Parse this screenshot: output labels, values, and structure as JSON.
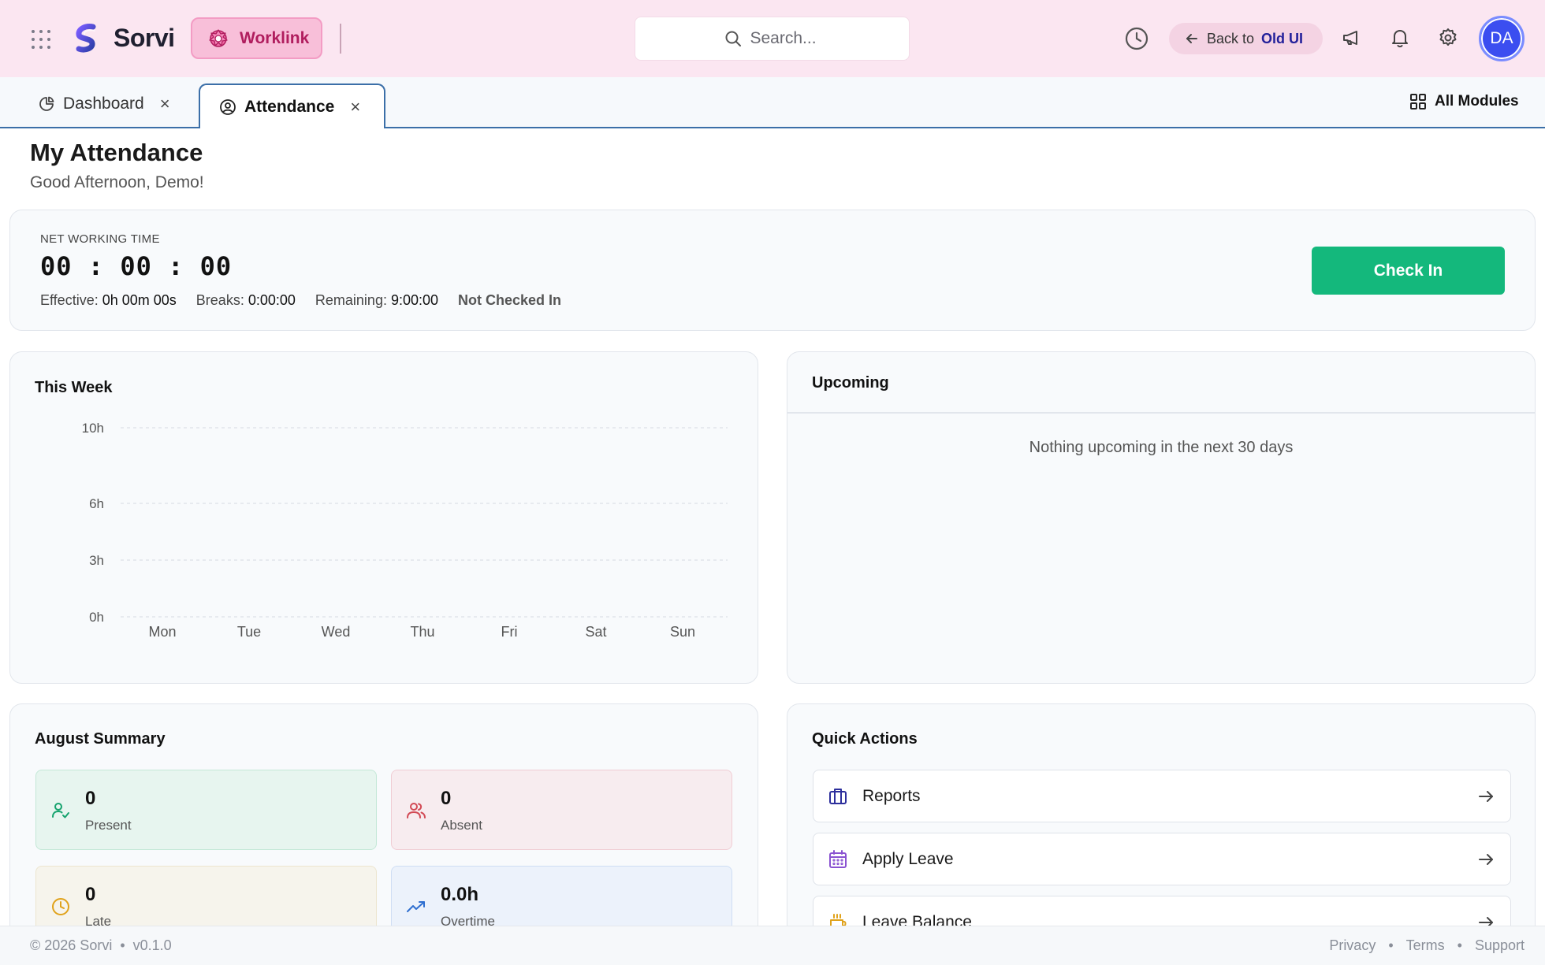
{
  "header": {
    "brand": "Sorvi",
    "module": "Worklink",
    "search_placeholder": "Search...",
    "back_prefix": "Back to",
    "back_target": "Old UI",
    "avatar_initials": "DA",
    "colors": {
      "header_bg": "#fbe6f1",
      "module_accent": "#b01d5e",
      "avatar": "#3b4ef0"
    }
  },
  "tabs": [
    {
      "label": "Dashboard",
      "icon": "pie-chart-icon",
      "active": false
    },
    {
      "label": "Attendance",
      "icon": "user-circle-icon",
      "active": true
    }
  ],
  "all_modules": "All Modules",
  "page": {
    "title": "My Attendance",
    "greeting": "Good Afternoon, Demo!"
  },
  "net": {
    "label": "NET WORKING TIME",
    "timer": "00 : 00 : 00",
    "effective_label": "Effective:",
    "effective_value": "0h 00m 00s",
    "breaks_label": "Breaks:",
    "breaks_value": "0:00:00",
    "remaining_label": "Remaining:",
    "remaining_value": "9:00:00",
    "status": "Not Checked In",
    "checkin_label": "Check In",
    "checkin_color": "#14b87c"
  },
  "week": {
    "title": "This Week"
  },
  "chart_data": {
    "type": "bar",
    "title": "This Week",
    "categories": [
      "Mon",
      "Tue",
      "Wed",
      "Thu",
      "Fri",
      "Sat",
      "Sun"
    ],
    "values": [
      0,
      0,
      0,
      0,
      0,
      0,
      0
    ],
    "y_ticks": [
      "0h",
      "3h",
      "6h",
      "10h"
    ],
    "y_tick_values": [
      0,
      3,
      6,
      10
    ],
    "ylim": [
      0,
      10
    ],
    "grid": true
  },
  "upcoming": {
    "title": "Upcoming",
    "empty": "Nothing upcoming in the next 30 days"
  },
  "summary": {
    "title": "August Summary",
    "tiles": [
      {
        "value": "0",
        "label": "Present",
        "icon": "user-check-icon",
        "color": "#16a36e"
      },
      {
        "value": "0",
        "label": "Absent",
        "icon": "users-icon",
        "color": "#d24a55"
      },
      {
        "value": "0",
        "label": "Late",
        "icon": "clock-icon",
        "color": "#e0a21a"
      },
      {
        "value": "0.0h",
        "label": "Overtime",
        "icon": "trending-up-icon",
        "color": "#2f6fd0"
      }
    ]
  },
  "quick_actions": {
    "title": "Quick Actions",
    "items": [
      {
        "label": "Reports",
        "icon": "briefcase-icon",
        "color": "#2d2f9c"
      },
      {
        "label": "Apply Leave",
        "icon": "calendar-icon",
        "color": "#8a52d1"
      },
      {
        "label": "Leave Balance",
        "icon": "coffee-icon",
        "color": "#e0a21a"
      }
    ]
  },
  "footer": {
    "copyright": "© 2026 Sorvi",
    "version": "v0.1.0",
    "links": [
      "Privacy",
      "Terms",
      "Support"
    ]
  }
}
